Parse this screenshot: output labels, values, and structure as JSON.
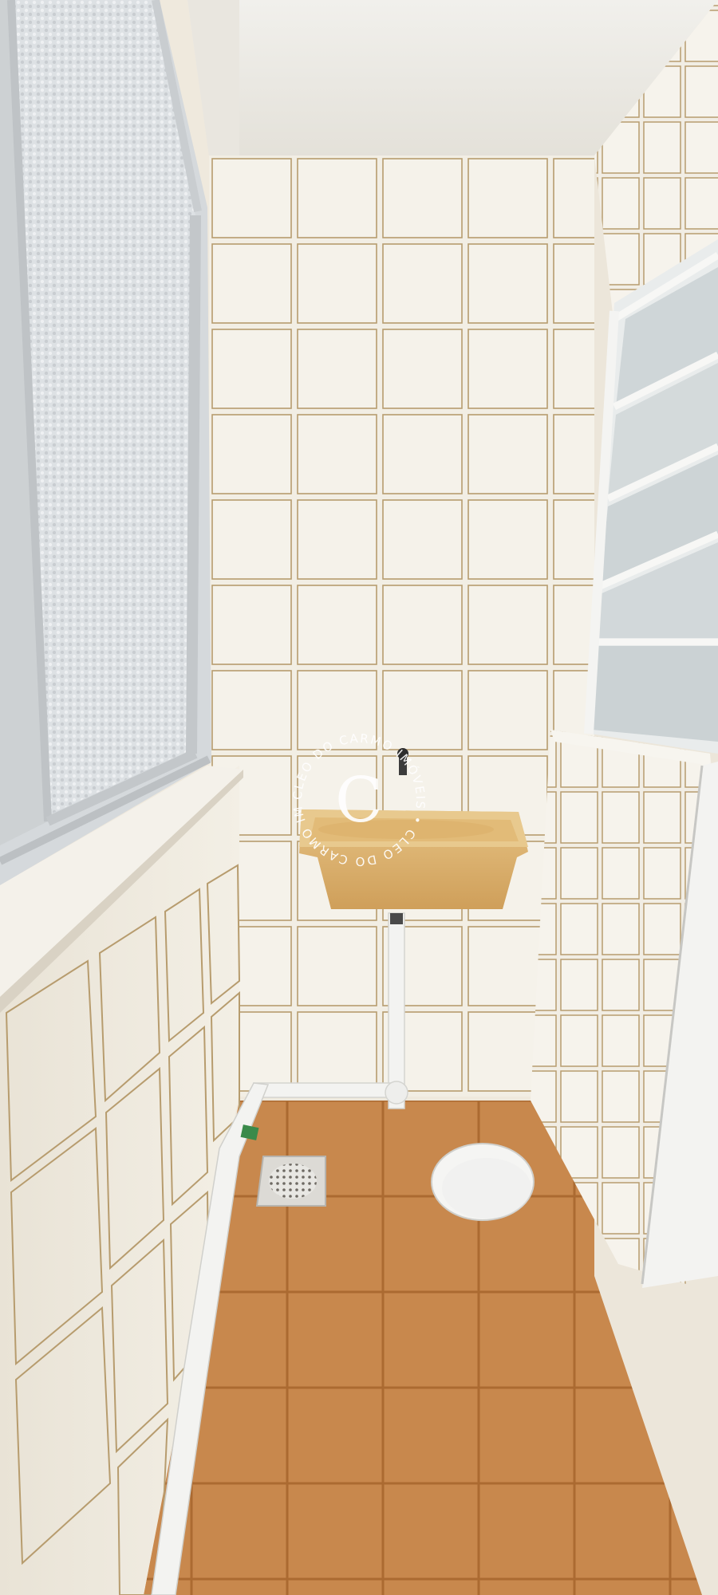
{
  "watermark": {
    "monogram": "C",
    "ring_text": "CLEO DO CARMO IMÓVEIS • CLEO DO CARMO IMÓVEIS •"
  },
  "colors": {
    "tile": "#f3efe6",
    "grout": "#a88f63",
    "floor": "#c98a4e",
    "floor_grout": "#a76a33",
    "sink": "#e0b775",
    "pipe": "#f2f2f0",
    "frosted_glass": "#dfe3e6",
    "frame": "#cfd3d4",
    "drain_cover": "#f5f5f3"
  },
  "objects": {
    "left_window": "frosted-glass-window",
    "right_window": "louvered-window",
    "sink": "laundry-tank",
    "pipe": "drain-pipe",
    "drain": "floor-drain-grate",
    "cover": "round-drain-cover"
  }
}
